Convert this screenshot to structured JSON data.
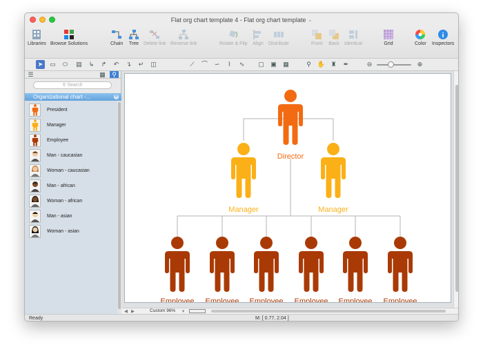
{
  "window": {
    "title": "Flat org chart template 4 - Flat org chart template"
  },
  "toolbar": {
    "libraries": "Libraries",
    "browse_solutions": "Browse Solutions",
    "chain": "Chain",
    "tree": "Tree",
    "delete_link": "Delete link",
    "reverse_link": "Reverse link",
    "rotate_flip": "Rotate & Flip",
    "align": "Align",
    "distribute": "Distribute",
    "front": "Front",
    "back": "Back",
    "identical": "Identical",
    "grid": "Grid",
    "color": "Color",
    "inspectors": "Inspectors"
  },
  "sidebar": {
    "search_placeholder": "Search",
    "library_title": "Organizational chart -...",
    "items": [
      {
        "label": "President",
        "icon": "person-orange"
      },
      {
        "label": "Manager",
        "icon": "person-yellow"
      },
      {
        "label": "Employee",
        "icon": "person-brown"
      },
      {
        "label": "Man - caucasian",
        "icon": "avatar-man"
      },
      {
        "label": "Woman - caucasian",
        "icon": "avatar-woman"
      },
      {
        "label": "Man - african",
        "icon": "avatar-man"
      },
      {
        "label": "Woman - african",
        "icon": "avatar-woman"
      },
      {
        "label": "Man - asian",
        "icon": "avatar-man"
      },
      {
        "label": "Woman - asian",
        "icon": "avatar-woman"
      }
    ]
  },
  "diagram": {
    "director": "Director",
    "managers": [
      "Manager",
      "Manager"
    ],
    "employees": [
      "Employee",
      "Employee",
      "Employee",
      "Employee",
      "Employee",
      "Employee"
    ],
    "colors": {
      "director": "#f26a12",
      "manager": "#fbb018",
      "employee": "#aa3a05",
      "line": "#b3b3b3"
    }
  },
  "zoom": {
    "label": "Custom 96%"
  },
  "status": {
    "left": "Ready",
    "mouse": "M: [ 0.77, 2.04 ]"
  }
}
